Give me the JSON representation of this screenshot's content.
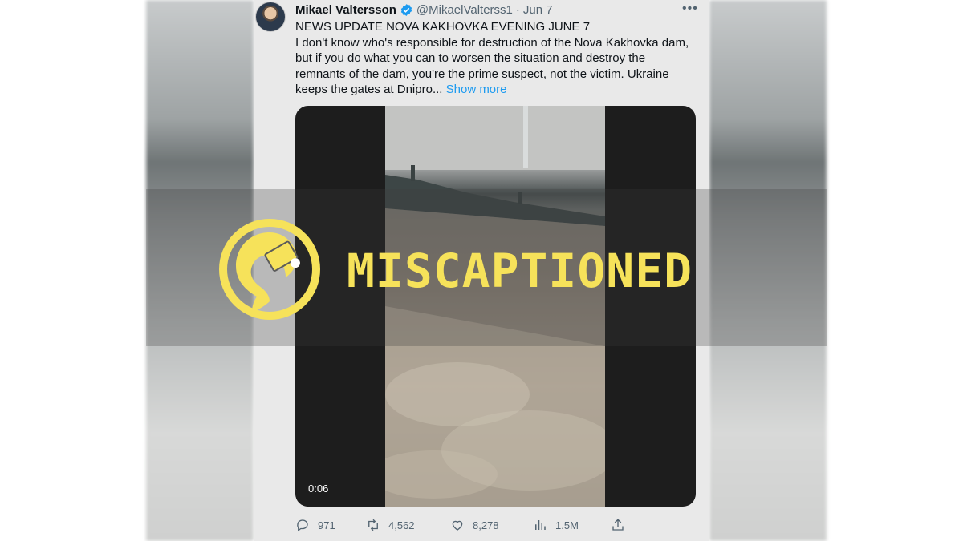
{
  "tweet": {
    "author_name": "Mikael Valtersson",
    "handle": "@MikaelValterss1",
    "separator": "·",
    "date": "Jun 7",
    "more_menu": "•••",
    "text_lines": [
      "NEWS UPDATE NOVA KAKHOVKA EVENING JUNE 7",
      "I don't know who's responsible for destruction of the Nova Kakhovka dam,",
      "but if you do what you can to worsen the situation and destroy the",
      "remnants of the dam, you're the prime suspect, not the victim. Ukraine",
      "keeps the gates at Dnipro..."
    ],
    "show_more": "Show more",
    "video_time": "0:06",
    "replies": "971",
    "retweets": "4,562",
    "likes": "8,278",
    "views": "1.5M"
  },
  "overlay": {
    "rating_label": "MISCAPTIONED",
    "accent_color": "#f6e25a"
  },
  "icons": {
    "verified": "verified-badge-icon",
    "reply": "reply-icon",
    "retweet": "retweet-icon",
    "like": "heart-icon",
    "views": "views-chart-icon",
    "share": "share-icon"
  }
}
